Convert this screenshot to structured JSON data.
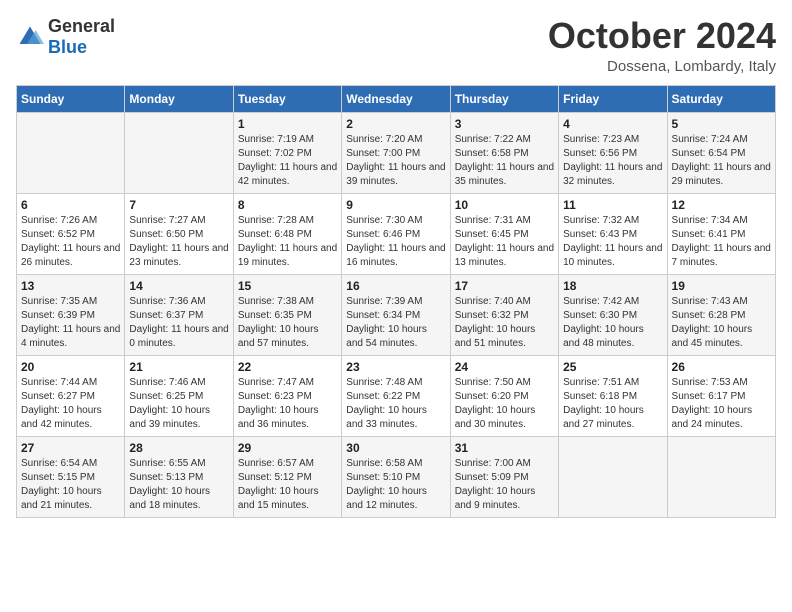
{
  "logo": {
    "general": "General",
    "blue": "Blue"
  },
  "header": {
    "month_year": "October 2024",
    "location": "Dossena, Lombardy, Italy"
  },
  "days_of_week": [
    "Sunday",
    "Monday",
    "Tuesday",
    "Wednesday",
    "Thursday",
    "Friday",
    "Saturday"
  ],
  "weeks": [
    [
      {
        "day": "",
        "sunrise": "",
        "sunset": "",
        "daylight": ""
      },
      {
        "day": "",
        "sunrise": "",
        "sunset": "",
        "daylight": ""
      },
      {
        "day": "1",
        "sunrise": "Sunrise: 7:19 AM",
        "sunset": "Sunset: 7:02 PM",
        "daylight": "Daylight: 11 hours and 42 minutes."
      },
      {
        "day": "2",
        "sunrise": "Sunrise: 7:20 AM",
        "sunset": "Sunset: 7:00 PM",
        "daylight": "Daylight: 11 hours and 39 minutes."
      },
      {
        "day": "3",
        "sunrise": "Sunrise: 7:22 AM",
        "sunset": "Sunset: 6:58 PM",
        "daylight": "Daylight: 11 hours and 35 minutes."
      },
      {
        "day": "4",
        "sunrise": "Sunrise: 7:23 AM",
        "sunset": "Sunset: 6:56 PM",
        "daylight": "Daylight: 11 hours and 32 minutes."
      },
      {
        "day": "5",
        "sunrise": "Sunrise: 7:24 AM",
        "sunset": "Sunset: 6:54 PM",
        "daylight": "Daylight: 11 hours and 29 minutes."
      }
    ],
    [
      {
        "day": "6",
        "sunrise": "Sunrise: 7:26 AM",
        "sunset": "Sunset: 6:52 PM",
        "daylight": "Daylight: 11 hours and 26 minutes."
      },
      {
        "day": "7",
        "sunrise": "Sunrise: 7:27 AM",
        "sunset": "Sunset: 6:50 PM",
        "daylight": "Daylight: 11 hours and 23 minutes."
      },
      {
        "day": "8",
        "sunrise": "Sunrise: 7:28 AM",
        "sunset": "Sunset: 6:48 PM",
        "daylight": "Daylight: 11 hours and 19 minutes."
      },
      {
        "day": "9",
        "sunrise": "Sunrise: 7:30 AM",
        "sunset": "Sunset: 6:46 PM",
        "daylight": "Daylight: 11 hours and 16 minutes."
      },
      {
        "day": "10",
        "sunrise": "Sunrise: 7:31 AM",
        "sunset": "Sunset: 6:45 PM",
        "daylight": "Daylight: 11 hours and 13 minutes."
      },
      {
        "day": "11",
        "sunrise": "Sunrise: 7:32 AM",
        "sunset": "Sunset: 6:43 PM",
        "daylight": "Daylight: 11 hours and 10 minutes."
      },
      {
        "day": "12",
        "sunrise": "Sunrise: 7:34 AM",
        "sunset": "Sunset: 6:41 PM",
        "daylight": "Daylight: 11 hours and 7 minutes."
      }
    ],
    [
      {
        "day": "13",
        "sunrise": "Sunrise: 7:35 AM",
        "sunset": "Sunset: 6:39 PM",
        "daylight": "Daylight: 11 hours and 4 minutes."
      },
      {
        "day": "14",
        "sunrise": "Sunrise: 7:36 AM",
        "sunset": "Sunset: 6:37 PM",
        "daylight": "Daylight: 11 hours and 0 minutes."
      },
      {
        "day": "15",
        "sunrise": "Sunrise: 7:38 AM",
        "sunset": "Sunset: 6:35 PM",
        "daylight": "Daylight: 10 hours and 57 minutes."
      },
      {
        "day": "16",
        "sunrise": "Sunrise: 7:39 AM",
        "sunset": "Sunset: 6:34 PM",
        "daylight": "Daylight: 10 hours and 54 minutes."
      },
      {
        "day": "17",
        "sunrise": "Sunrise: 7:40 AM",
        "sunset": "Sunset: 6:32 PM",
        "daylight": "Daylight: 10 hours and 51 minutes."
      },
      {
        "day": "18",
        "sunrise": "Sunrise: 7:42 AM",
        "sunset": "Sunset: 6:30 PM",
        "daylight": "Daylight: 10 hours and 48 minutes."
      },
      {
        "day": "19",
        "sunrise": "Sunrise: 7:43 AM",
        "sunset": "Sunset: 6:28 PM",
        "daylight": "Daylight: 10 hours and 45 minutes."
      }
    ],
    [
      {
        "day": "20",
        "sunrise": "Sunrise: 7:44 AM",
        "sunset": "Sunset: 6:27 PM",
        "daylight": "Daylight: 10 hours and 42 minutes."
      },
      {
        "day": "21",
        "sunrise": "Sunrise: 7:46 AM",
        "sunset": "Sunset: 6:25 PM",
        "daylight": "Daylight: 10 hours and 39 minutes."
      },
      {
        "day": "22",
        "sunrise": "Sunrise: 7:47 AM",
        "sunset": "Sunset: 6:23 PM",
        "daylight": "Daylight: 10 hours and 36 minutes."
      },
      {
        "day": "23",
        "sunrise": "Sunrise: 7:48 AM",
        "sunset": "Sunset: 6:22 PM",
        "daylight": "Daylight: 10 hours and 33 minutes."
      },
      {
        "day": "24",
        "sunrise": "Sunrise: 7:50 AM",
        "sunset": "Sunset: 6:20 PM",
        "daylight": "Daylight: 10 hours and 30 minutes."
      },
      {
        "day": "25",
        "sunrise": "Sunrise: 7:51 AM",
        "sunset": "Sunset: 6:18 PM",
        "daylight": "Daylight: 10 hours and 27 minutes."
      },
      {
        "day": "26",
        "sunrise": "Sunrise: 7:53 AM",
        "sunset": "Sunset: 6:17 PM",
        "daylight": "Daylight: 10 hours and 24 minutes."
      }
    ],
    [
      {
        "day": "27",
        "sunrise": "Sunrise: 6:54 AM",
        "sunset": "Sunset: 5:15 PM",
        "daylight": "Daylight: 10 hours and 21 minutes."
      },
      {
        "day": "28",
        "sunrise": "Sunrise: 6:55 AM",
        "sunset": "Sunset: 5:13 PM",
        "daylight": "Daylight: 10 hours and 18 minutes."
      },
      {
        "day": "29",
        "sunrise": "Sunrise: 6:57 AM",
        "sunset": "Sunset: 5:12 PM",
        "daylight": "Daylight: 10 hours and 15 minutes."
      },
      {
        "day": "30",
        "sunrise": "Sunrise: 6:58 AM",
        "sunset": "Sunset: 5:10 PM",
        "daylight": "Daylight: 10 hours and 12 minutes."
      },
      {
        "day": "31",
        "sunrise": "Sunrise: 7:00 AM",
        "sunset": "Sunset: 5:09 PM",
        "daylight": "Daylight: 10 hours and 9 minutes."
      },
      {
        "day": "",
        "sunrise": "",
        "sunset": "",
        "daylight": ""
      },
      {
        "day": "",
        "sunrise": "",
        "sunset": "",
        "daylight": ""
      }
    ]
  ]
}
